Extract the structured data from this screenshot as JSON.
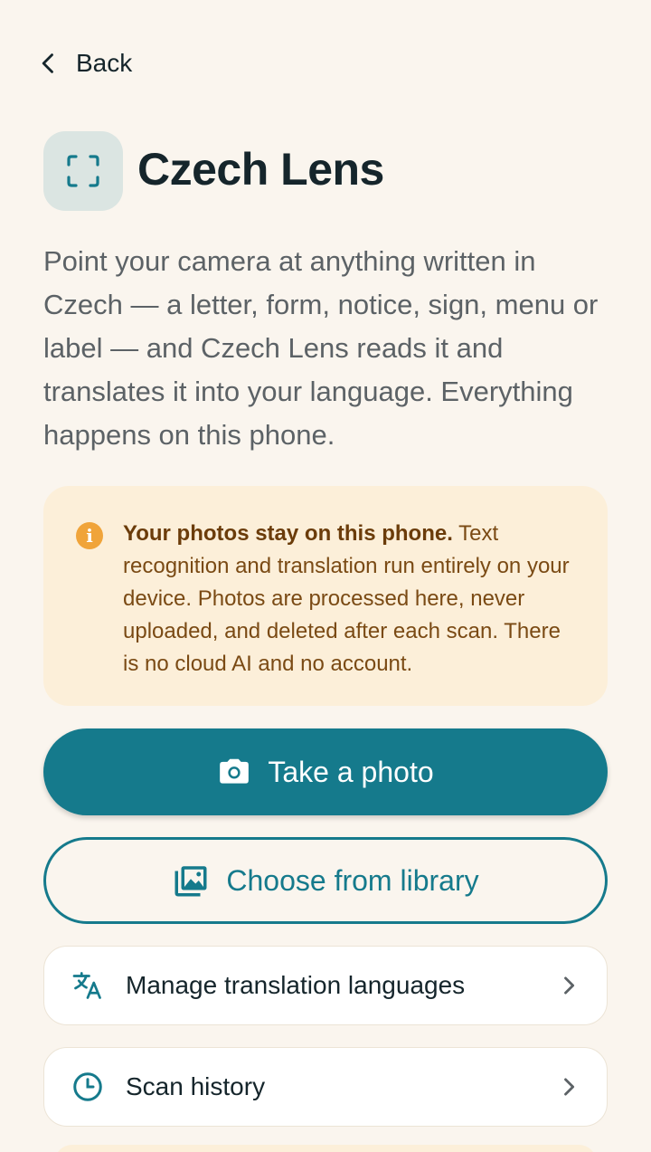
{
  "nav": {
    "back_label": "Back"
  },
  "header": {
    "title": "Czech Lens",
    "icon": "scan-frame-icon"
  },
  "intro": "Point your camera at anything written in Czech — a letter, form, notice, sign, menu or label — and Czech Lens reads it and translates it into your language. Everything happens on this phone.",
  "notice": {
    "icon": "info-icon",
    "bold": "Your photos stay on this phone.",
    "text": " Text recognition and translation run entirely on your device. Photos are processed here, never uploaded, and deleted after each scan. There is no cloud AI and no account."
  },
  "actions": {
    "take_photo": "Take a photo",
    "choose_library": "Choose from library"
  },
  "menu": [
    {
      "label": "Manage translation languages",
      "icon": "translate-icon"
    },
    {
      "label": "Scan history",
      "icon": "clock-icon"
    }
  ],
  "colors": {
    "accent": "#157a8c",
    "background": "#faf5ee",
    "notice_bg": "#fcefd9",
    "notice_icon": "#f0a43a"
  }
}
